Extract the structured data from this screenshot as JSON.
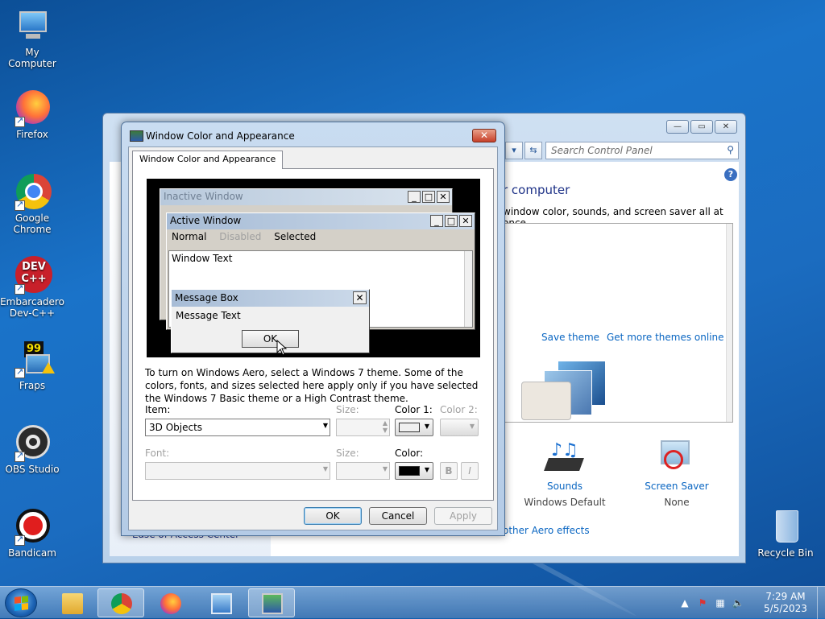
{
  "desktop": {
    "icons": [
      {
        "label": "My Computer"
      },
      {
        "label": "Firefox"
      },
      {
        "label": "Google Chrome"
      },
      {
        "label": "Embarcadero Dev-C++"
      },
      {
        "label": "Fraps"
      },
      {
        "label": "OBS Studio"
      },
      {
        "label": "Bandicam"
      },
      {
        "label": "Recycle Bin"
      }
    ]
  },
  "control_panel": {
    "search_placeholder": "Search Control Panel",
    "heading": "r computer",
    "description": "window color, sounds, and screen saver all at once.",
    "save_theme": "Save theme",
    "get_more_themes": "Get more themes online",
    "sounds_label": "Sounds",
    "sounds_value": "Windows Default",
    "screensaver_label": "Screen Saver",
    "screensaver_value": "None",
    "aero_link": "other Aero effects",
    "sidebar_link": "Ease of Access Center"
  },
  "dialog": {
    "title": "Window Color and Appearance",
    "tab": "Window Color and Appearance",
    "preview": {
      "inactive_title": "Inactive Window",
      "active_title": "Active Window",
      "menu_normal": "Normal",
      "menu_disabled": "Disabled",
      "menu_selected": "Selected",
      "window_text": "Window Text",
      "message_box_title": "Message Box",
      "message_text": "Message Text",
      "ok": "OK"
    },
    "info": "To turn on Windows Aero, select a Windows 7 theme.  Some of the colors, fonts, and sizes selected here apply only if you have selected the Windows 7 Basic theme or a High Contrast theme.",
    "item_label": "Item:",
    "item_value": "3D Objects",
    "size_label": "Size:",
    "color1_label": "Color 1:",
    "color2_label": "Color 2:",
    "font_label": "Font:",
    "font_size_label": "Size:",
    "color_label": "Color:",
    "bold": "B",
    "italic": "I",
    "color1_value": "#f0f0f0",
    "font_color_value": "#000000",
    "ok_button": "OK",
    "cancel_button": "Cancel",
    "apply_button": "Apply"
  },
  "taskbar": {
    "time": "7:29 AM",
    "date": "5/5/2023"
  }
}
